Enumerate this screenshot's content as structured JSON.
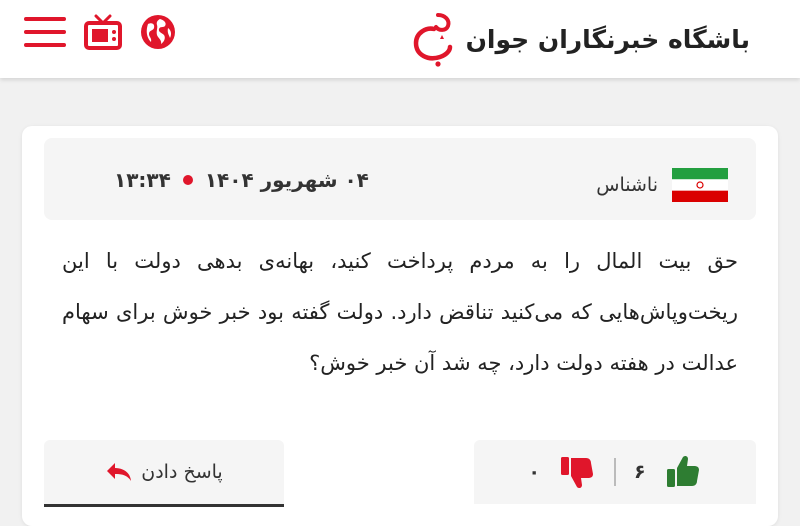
{
  "header": {
    "site_name": "باشگاه خبرنگاران جوان",
    "icons": [
      "menu-icon",
      "tv-icon",
      "globe-icon",
      "yjc-logo"
    ],
    "accent_color": "#e0162b"
  },
  "comment": {
    "author": "ناشناس",
    "flag": "iran-flag",
    "date": "۰۴ شهریور ۱۴۰۴",
    "time": "۱۳:۳۴",
    "text": "حق بیت المال را به مردم پرداخت کنید، بهانه‌ی بدهی دولت با این ریخت‌وپاش‌هایی که می‌کنید تناقض دارد. دولت گفته بود خبر خوش برای سهام عدالت در هفته دولت دارد، چه شد آن خبر خوش؟",
    "dislikes": "۰",
    "likes": "۶",
    "reply_label": "پاسخ دادن"
  }
}
